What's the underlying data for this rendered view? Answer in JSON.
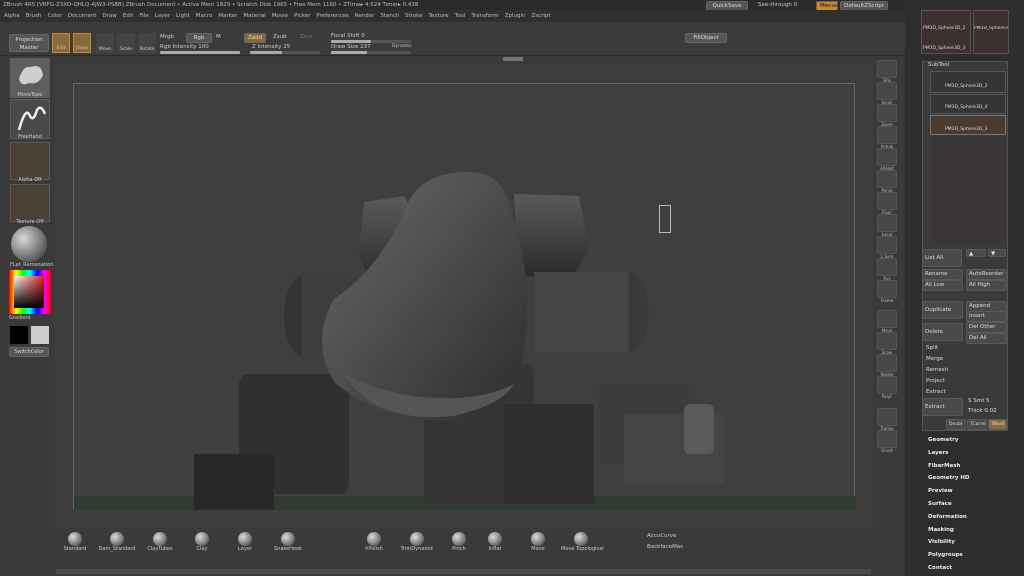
{
  "titlebar": {
    "text": "ZBrush 4R5 [VRFG-Z3XO-QHLQ-AJW3-PS8B]    ZBrush Document        • Active Mem 1829 • Scratch Disk 1965 • Free Mem 1160 • ZTime▸ 4.524 Timer▸ 0.438",
    "quicksave": "QuickSave",
    "seethrough": "See-through",
    "seethrough_val": "0",
    "menus_btn": "Menus",
    "defaultscript": "DefaultZScript"
  },
  "menus": [
    "Alpha",
    "Brush",
    "Color",
    "Document",
    "Draw",
    "Edit",
    "File",
    "Layer",
    "Light",
    "Macro",
    "Marker",
    "Material",
    "Movie",
    "Picker",
    "Preferences",
    "Render",
    "Stencil",
    "Stroke",
    "Texture",
    "Tool",
    "Transform",
    "Zplugin",
    "Zscript"
  ],
  "topbar": {
    "projection_master": "Projection Master",
    "edit": "Edit",
    "draw": "Draw",
    "move": "Move",
    "scale": "Scale",
    "rotate": "Rotate",
    "mrgb": "Mrgb",
    "rgb": "Rgb",
    "m": "M",
    "rgb_intensity_label": "Rgb Intensity",
    "rgb_intensity": "100",
    "zadd": "Zadd",
    "zsub": "Zsub",
    "zcut": "Zcut",
    "z_intensity_label": "Z Intensity",
    "z_intensity": "25",
    "focal_shift_label": "Focal Shift",
    "focal_shift": "0",
    "draw_size_label": "Draw Size",
    "draw_size": "237",
    "dynamic": "Dynamic",
    "fill_object": "FillObject"
  },
  "leftshelf": {
    "brush_label": "MoveTopo",
    "stroke_label": "FreeHand",
    "alpha_label": "Alpha Off",
    "texture_label": "Texture Off",
    "material_label": "FLat_Ramenation",
    "gradient": "Gradient",
    "switch_color": "SwitchColor"
  },
  "rightshelf": [
    "SPix",
    "Scroll",
    "Zoom",
    "Actual",
    "AAHalf",
    "Persp",
    "Floor",
    "Local",
    "L.Sym",
    "Xyz",
    "Frame",
    "Move",
    "Scale",
    "Rotate",
    "PolyF",
    "Transp",
    "Ghost"
  ],
  "colors": {
    "background": "#3a3a3a",
    "accent": "#d08a2a",
    "fill_object": "#555555"
  },
  "brushes": [
    "Standard",
    "Dam_Standard",
    "ClayTubes",
    "Clay",
    "Layer",
    "SnakeHook",
    "hPolish",
    "TrimDynamic",
    "Pinch",
    "Inflat",
    "Move",
    "Move Topological"
  ],
  "brush_options": {
    "accucurve": "AccuCurve",
    "backfacemask": "BackfaceMas"
  },
  "rightpanel": {
    "thumb1": "PM3D_Sphere3D_2",
    "thumb2": "PM3D_Sphere3D_3",
    "thumb3": "PM3D_Sphere3D_3",
    "subtool_title": "SubTool",
    "subtools": [
      "PM3D_Sphere3D_2",
      "PM3D_Sphere3D_4",
      "PM3D_Sphere3D_3"
    ],
    "list_all": "List All",
    "rename": "Rename",
    "autoreorder": "AutoReorder",
    "all_low": "All Low",
    "all_high": "All High",
    "duplicate": "Duplicate",
    "append": "Append",
    "insert": "Insert",
    "delete": "Delete",
    "del_other": "Del Other",
    "del_all": "Del All",
    "split": "Split",
    "merge": "Merge",
    "remesh": "Remesh",
    "project": "Project",
    "extract_section": "Extract",
    "extract_btn": "Extract",
    "smt_label": "S Smt",
    "smt": "5",
    "thick_label": "Thick",
    "thick": "0.02",
    "double": "Doubl",
    "tcorne": "TCorne",
    "tbord": "TBord",
    "sections": [
      "Geometry",
      "Layers",
      "FiberMesh",
      "Geometry HD",
      "Preview",
      "Surface",
      "Deformation",
      "Masking",
      "Visibility",
      "Polygroups",
      "Contact"
    ]
  }
}
